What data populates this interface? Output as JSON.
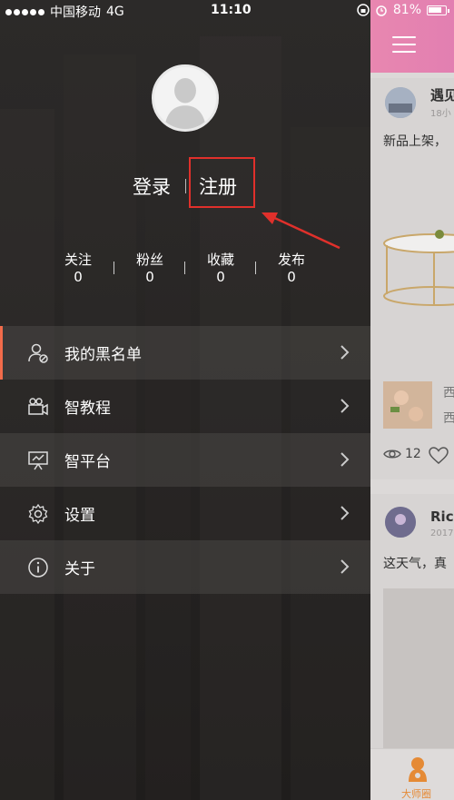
{
  "status_bar": {
    "carrier": "中国移动",
    "network": "4G",
    "time": "11:10",
    "battery": "81%"
  },
  "auth": {
    "login_label": "登录",
    "register_label": "注册"
  },
  "stats": [
    {
      "label": "关注",
      "value": "0"
    },
    {
      "label": "粉丝",
      "value": "0"
    },
    {
      "label": "收藏",
      "value": "0"
    },
    {
      "label": "发布",
      "value": "0"
    }
  ],
  "menu": [
    {
      "label": "我的黑名单",
      "icon": "user-block-icon"
    },
    {
      "label": "智教程",
      "icon": "video-camera-icon"
    },
    {
      "label": "智平台",
      "icon": "presentation-icon"
    },
    {
      "label": "设置",
      "icon": "gear-icon"
    },
    {
      "label": "关于",
      "icon": "info-icon"
    }
  ],
  "feed": {
    "post1": {
      "name": "遇见",
      "time": "18小",
      "text": "新品上架，",
      "views": "12"
    },
    "post1_thumb_text": [
      "西",
      "西"
    ],
    "post2": {
      "name": "Ric",
      "time": "2017",
      "text": "这天气，真"
    }
  },
  "tabbar": {
    "label": "大师圈"
  },
  "colors": {
    "accent": "#f26b4a",
    "annotation_red": "#e0302b",
    "header_pink": "#e887b0",
    "tab_orange": "#e58a35"
  }
}
